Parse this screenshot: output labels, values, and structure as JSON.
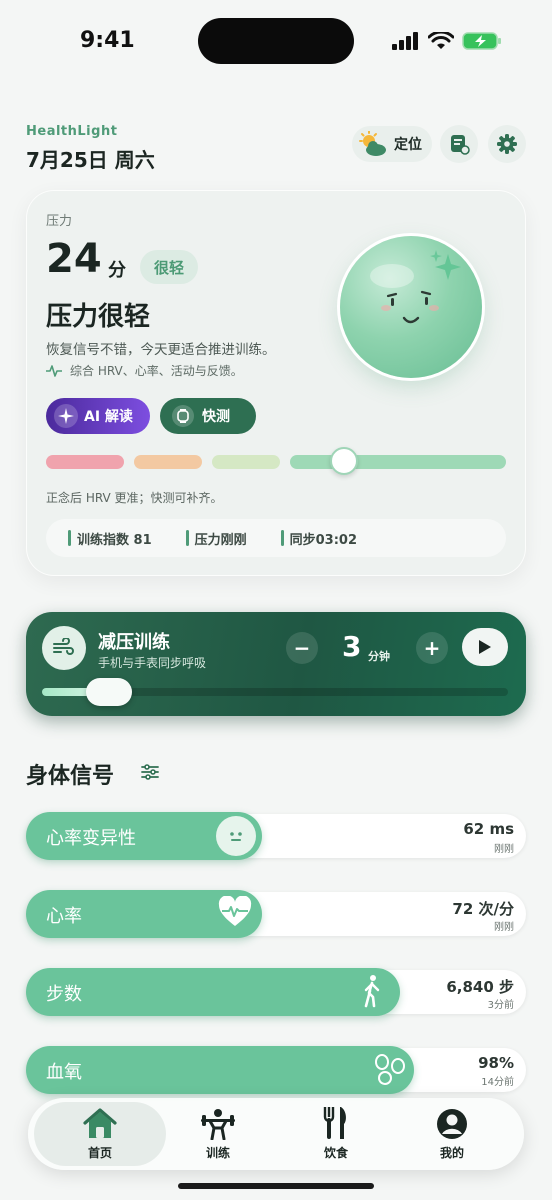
{
  "status_bar": {
    "time": "9:41"
  },
  "header": {
    "brand": "HealthLight",
    "date": "7月25日 周六",
    "location_label": "定位"
  },
  "stress": {
    "label": "压力",
    "score": "24",
    "unit": "分",
    "level_chip": "很轻",
    "headline": "压力很轻",
    "description": "恢复信号不错，今天更适合推进训练。",
    "sources": "综合 HRV、心率、活动与反馈。",
    "ai_button": "AI 解读",
    "quick_button": "快测",
    "scale_colors": [
      "#f0a3ad",
      "#f3c9a2",
      "#d5e8c4",
      "#9ed9b6"
    ],
    "scale_position_percent": 13,
    "note": "正念后 HRV 更准；快测可补齐。",
    "metrics": [
      "训练指数 81",
      "压力刚刚",
      "同步03:02"
    ]
  },
  "breathing": {
    "title": "减压训练",
    "subtitle": "手机与手表同步呼吸",
    "minus": "−",
    "plus": "+",
    "minutes": "3",
    "unit": "分钟",
    "progress_percent": 12
  },
  "body_signals": {
    "title": "身体信号",
    "items": [
      {
        "label": "心率变异性",
        "value": "62 ms",
        "time": "刚刚",
        "icon": "face-neutral-icon",
        "fill_percent": 47
      },
      {
        "label": "心率",
        "value": "72 次/分",
        "time": "刚刚",
        "icon": "heart-pulse-icon",
        "fill_percent": 47
      },
      {
        "label": "步数",
        "value": "6,840 步",
        "time": "3分前",
        "icon": "walking-icon",
        "fill_percent": 75
      },
      {
        "label": "血氧",
        "value": "98%",
        "time": "14分前",
        "icon": "blood-drops-icon",
        "fill_percent": 78
      }
    ]
  },
  "tabs": [
    {
      "label": "首页",
      "icon": "home-icon",
      "active": true
    },
    {
      "label": "训练",
      "icon": "weightlifting-icon",
      "active": false
    },
    {
      "label": "饮食",
      "icon": "fork-knife-icon",
      "active": false
    },
    {
      "label": "我的",
      "icon": "profile-icon",
      "active": false
    }
  ],
  "colors": {
    "accent": "#4f9b78",
    "signal_fill": "#6ac49b",
    "breath_bg": "#1f5743",
    "ai_purple": "#5b33b5"
  }
}
